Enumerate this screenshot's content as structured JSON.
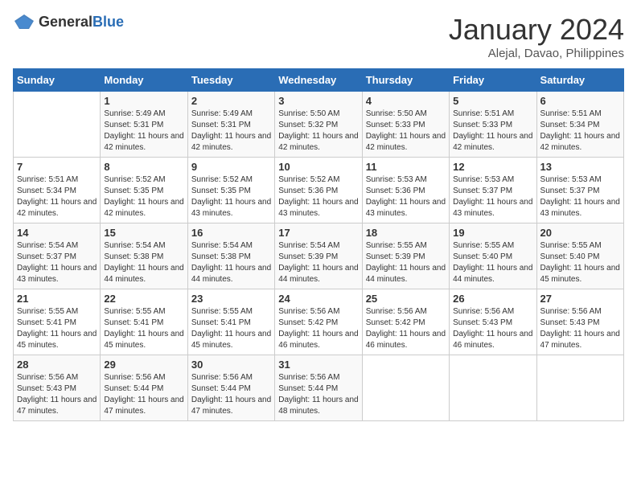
{
  "logo": {
    "general": "General",
    "blue": "Blue"
  },
  "title": "January 2024",
  "location": "Alejal, Davao, Philippines",
  "headers": [
    "Sunday",
    "Monday",
    "Tuesday",
    "Wednesday",
    "Thursday",
    "Friday",
    "Saturday"
  ],
  "weeks": [
    [
      {
        "day": "",
        "sunrise": "",
        "sunset": "",
        "daylight": ""
      },
      {
        "day": "1",
        "sunrise": "Sunrise: 5:49 AM",
        "sunset": "Sunset: 5:31 PM",
        "daylight": "Daylight: 11 hours and 42 minutes."
      },
      {
        "day": "2",
        "sunrise": "Sunrise: 5:49 AM",
        "sunset": "Sunset: 5:31 PM",
        "daylight": "Daylight: 11 hours and 42 minutes."
      },
      {
        "day": "3",
        "sunrise": "Sunrise: 5:50 AM",
        "sunset": "Sunset: 5:32 PM",
        "daylight": "Daylight: 11 hours and 42 minutes."
      },
      {
        "day": "4",
        "sunrise": "Sunrise: 5:50 AM",
        "sunset": "Sunset: 5:33 PM",
        "daylight": "Daylight: 11 hours and 42 minutes."
      },
      {
        "day": "5",
        "sunrise": "Sunrise: 5:51 AM",
        "sunset": "Sunset: 5:33 PM",
        "daylight": "Daylight: 11 hours and 42 minutes."
      },
      {
        "day": "6",
        "sunrise": "Sunrise: 5:51 AM",
        "sunset": "Sunset: 5:34 PM",
        "daylight": "Daylight: 11 hours and 42 minutes."
      }
    ],
    [
      {
        "day": "7",
        "sunrise": "Sunrise: 5:51 AM",
        "sunset": "Sunset: 5:34 PM",
        "daylight": "Daylight: 11 hours and 42 minutes."
      },
      {
        "day": "8",
        "sunrise": "Sunrise: 5:52 AM",
        "sunset": "Sunset: 5:35 PM",
        "daylight": "Daylight: 11 hours and 42 minutes."
      },
      {
        "day": "9",
        "sunrise": "Sunrise: 5:52 AM",
        "sunset": "Sunset: 5:35 PM",
        "daylight": "Daylight: 11 hours and 43 minutes."
      },
      {
        "day": "10",
        "sunrise": "Sunrise: 5:52 AM",
        "sunset": "Sunset: 5:36 PM",
        "daylight": "Daylight: 11 hours and 43 minutes."
      },
      {
        "day": "11",
        "sunrise": "Sunrise: 5:53 AM",
        "sunset": "Sunset: 5:36 PM",
        "daylight": "Daylight: 11 hours and 43 minutes."
      },
      {
        "day": "12",
        "sunrise": "Sunrise: 5:53 AM",
        "sunset": "Sunset: 5:37 PM",
        "daylight": "Daylight: 11 hours and 43 minutes."
      },
      {
        "day": "13",
        "sunrise": "Sunrise: 5:53 AM",
        "sunset": "Sunset: 5:37 PM",
        "daylight": "Daylight: 11 hours and 43 minutes."
      }
    ],
    [
      {
        "day": "14",
        "sunrise": "Sunrise: 5:54 AM",
        "sunset": "Sunset: 5:37 PM",
        "daylight": "Daylight: 11 hours and 43 minutes."
      },
      {
        "day": "15",
        "sunrise": "Sunrise: 5:54 AM",
        "sunset": "Sunset: 5:38 PM",
        "daylight": "Daylight: 11 hours and 44 minutes."
      },
      {
        "day": "16",
        "sunrise": "Sunrise: 5:54 AM",
        "sunset": "Sunset: 5:38 PM",
        "daylight": "Daylight: 11 hours and 44 minutes."
      },
      {
        "day": "17",
        "sunrise": "Sunrise: 5:54 AM",
        "sunset": "Sunset: 5:39 PM",
        "daylight": "Daylight: 11 hours and 44 minutes."
      },
      {
        "day": "18",
        "sunrise": "Sunrise: 5:55 AM",
        "sunset": "Sunset: 5:39 PM",
        "daylight": "Daylight: 11 hours and 44 minutes."
      },
      {
        "day": "19",
        "sunrise": "Sunrise: 5:55 AM",
        "sunset": "Sunset: 5:40 PM",
        "daylight": "Daylight: 11 hours and 44 minutes."
      },
      {
        "day": "20",
        "sunrise": "Sunrise: 5:55 AM",
        "sunset": "Sunset: 5:40 PM",
        "daylight": "Daylight: 11 hours and 45 minutes."
      }
    ],
    [
      {
        "day": "21",
        "sunrise": "Sunrise: 5:55 AM",
        "sunset": "Sunset: 5:41 PM",
        "daylight": "Daylight: 11 hours and 45 minutes."
      },
      {
        "day": "22",
        "sunrise": "Sunrise: 5:55 AM",
        "sunset": "Sunset: 5:41 PM",
        "daylight": "Daylight: 11 hours and 45 minutes."
      },
      {
        "day": "23",
        "sunrise": "Sunrise: 5:55 AM",
        "sunset": "Sunset: 5:41 PM",
        "daylight": "Daylight: 11 hours and 45 minutes."
      },
      {
        "day": "24",
        "sunrise": "Sunrise: 5:56 AM",
        "sunset": "Sunset: 5:42 PM",
        "daylight": "Daylight: 11 hours and 46 minutes."
      },
      {
        "day": "25",
        "sunrise": "Sunrise: 5:56 AM",
        "sunset": "Sunset: 5:42 PM",
        "daylight": "Daylight: 11 hours and 46 minutes."
      },
      {
        "day": "26",
        "sunrise": "Sunrise: 5:56 AM",
        "sunset": "Sunset: 5:43 PM",
        "daylight": "Daylight: 11 hours and 46 minutes."
      },
      {
        "day": "27",
        "sunrise": "Sunrise: 5:56 AM",
        "sunset": "Sunset: 5:43 PM",
        "daylight": "Daylight: 11 hours and 47 minutes."
      }
    ],
    [
      {
        "day": "28",
        "sunrise": "Sunrise: 5:56 AM",
        "sunset": "Sunset: 5:43 PM",
        "daylight": "Daylight: 11 hours and 47 minutes."
      },
      {
        "day": "29",
        "sunrise": "Sunrise: 5:56 AM",
        "sunset": "Sunset: 5:44 PM",
        "daylight": "Daylight: 11 hours and 47 minutes."
      },
      {
        "day": "30",
        "sunrise": "Sunrise: 5:56 AM",
        "sunset": "Sunset: 5:44 PM",
        "daylight": "Daylight: 11 hours and 47 minutes."
      },
      {
        "day": "31",
        "sunrise": "Sunrise: 5:56 AM",
        "sunset": "Sunset: 5:44 PM",
        "daylight": "Daylight: 11 hours and 48 minutes."
      },
      {
        "day": "",
        "sunrise": "",
        "sunset": "",
        "daylight": ""
      },
      {
        "day": "",
        "sunrise": "",
        "sunset": "",
        "daylight": ""
      },
      {
        "day": "",
        "sunrise": "",
        "sunset": "",
        "daylight": ""
      }
    ]
  ]
}
